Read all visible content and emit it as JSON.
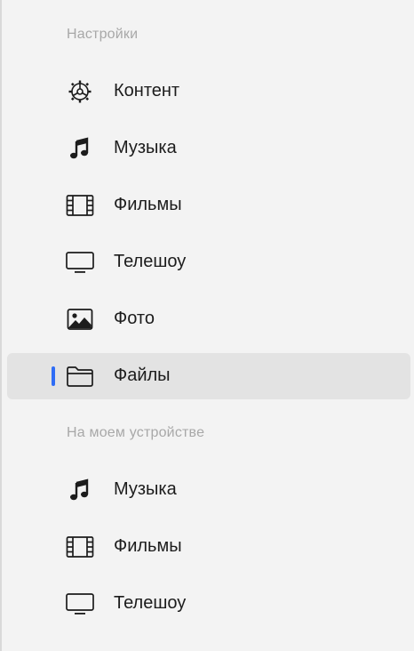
{
  "sections": [
    {
      "title": "Настройки",
      "items": [
        {
          "label": "Контент",
          "icon": "gear-icon"
        },
        {
          "label": "Музыка",
          "icon": "music-note-icon"
        },
        {
          "label": "Фильмы",
          "icon": "film-icon"
        },
        {
          "label": "Телешоу",
          "icon": "tv-icon"
        },
        {
          "label": "Фото",
          "icon": "photo-icon"
        },
        {
          "label": "Файлы",
          "icon": "folder-icon",
          "selected": true
        }
      ]
    },
    {
      "title": "На моем устройстве",
      "items": [
        {
          "label": "Музыка",
          "icon": "music-note-icon"
        },
        {
          "label": "Фильмы",
          "icon": "film-icon"
        },
        {
          "label": "Телешоу",
          "icon": "tv-icon"
        }
      ]
    }
  ],
  "colors": {
    "accent": "#2f6df6",
    "background": "#f3f3f3",
    "selected_bg": "#e3e3e3",
    "section_title": "#a8a8a8",
    "label": "#1c1c1c"
  }
}
